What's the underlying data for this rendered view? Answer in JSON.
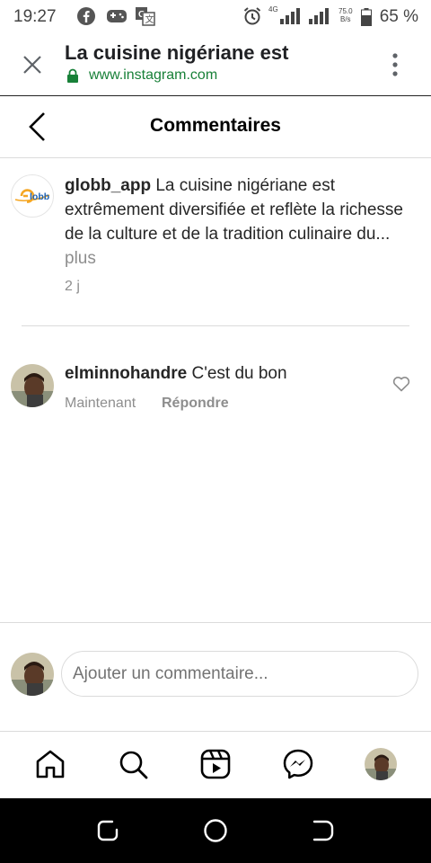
{
  "status_bar": {
    "time": "19:27",
    "network": "4G",
    "speed_value": "75.0",
    "speed_unit": "B/s",
    "battery": "65 %"
  },
  "browser": {
    "title": "La cuisine nigériane est",
    "url": "www.instagram.com"
  },
  "header": {
    "title": "Commentaires"
  },
  "caption": {
    "username": "globb_app",
    "text": "La cuisine nigériane est extrêmement diversifiée et reflète la richesse de la culture et de la tradition culinaire du...",
    "more": "plus",
    "time": "2 j",
    "avatar_text": "Globb"
  },
  "comment": {
    "username": "elminnohandre",
    "text": "C'est du bon",
    "time": "Maintenant",
    "reply": "Répondre"
  },
  "input": {
    "placeholder": "Ajouter un commentaire..."
  },
  "colors": {
    "url_green": "#188038",
    "muted": "#8e8e8e",
    "divider": "#dbdbdb",
    "logo_orange": "#f5a623",
    "logo_blue": "#1e63b5"
  }
}
